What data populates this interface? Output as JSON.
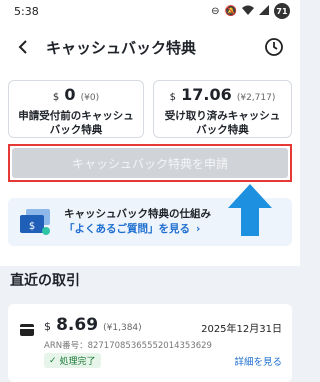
{
  "status_bar": {
    "time": "5:38",
    "battery": "71"
  },
  "header": {
    "title": "キャッシュバック特典"
  },
  "cards": [
    {
      "currency": "$",
      "amount": "0",
      "yen": "(¥0)",
      "label_line1": "申請受付前のキャッシュ",
      "label_line2": "バック特典"
    },
    {
      "currency": "$",
      "amount": "17.06",
      "yen": "(¥2,717)",
      "label_line1": "受け取り済みキャッシュ",
      "label_line2": "バック特典"
    }
  ],
  "apply_button": {
    "label": "キャッシュバック特典を申請"
  },
  "info": {
    "title": "キャッシュバック特典の仕組み",
    "link": "「よくあるご質問」を見る",
    "link_chevron": "›"
  },
  "recent": {
    "title": "直近の取引"
  },
  "transactions": [
    {
      "currency": "$",
      "amount": "8.69",
      "yen": "(¥1,384)",
      "date": "2025年12月31日",
      "arn": "ARN番号：82717085365552014353629",
      "status": "処理完了",
      "detail_link": "詳細を見る"
    }
  ],
  "colors": {
    "highlight_border": "#e53935",
    "link": "#1f6fd1",
    "arrow": "#1e90e0",
    "success": "#1e7a3a"
  }
}
